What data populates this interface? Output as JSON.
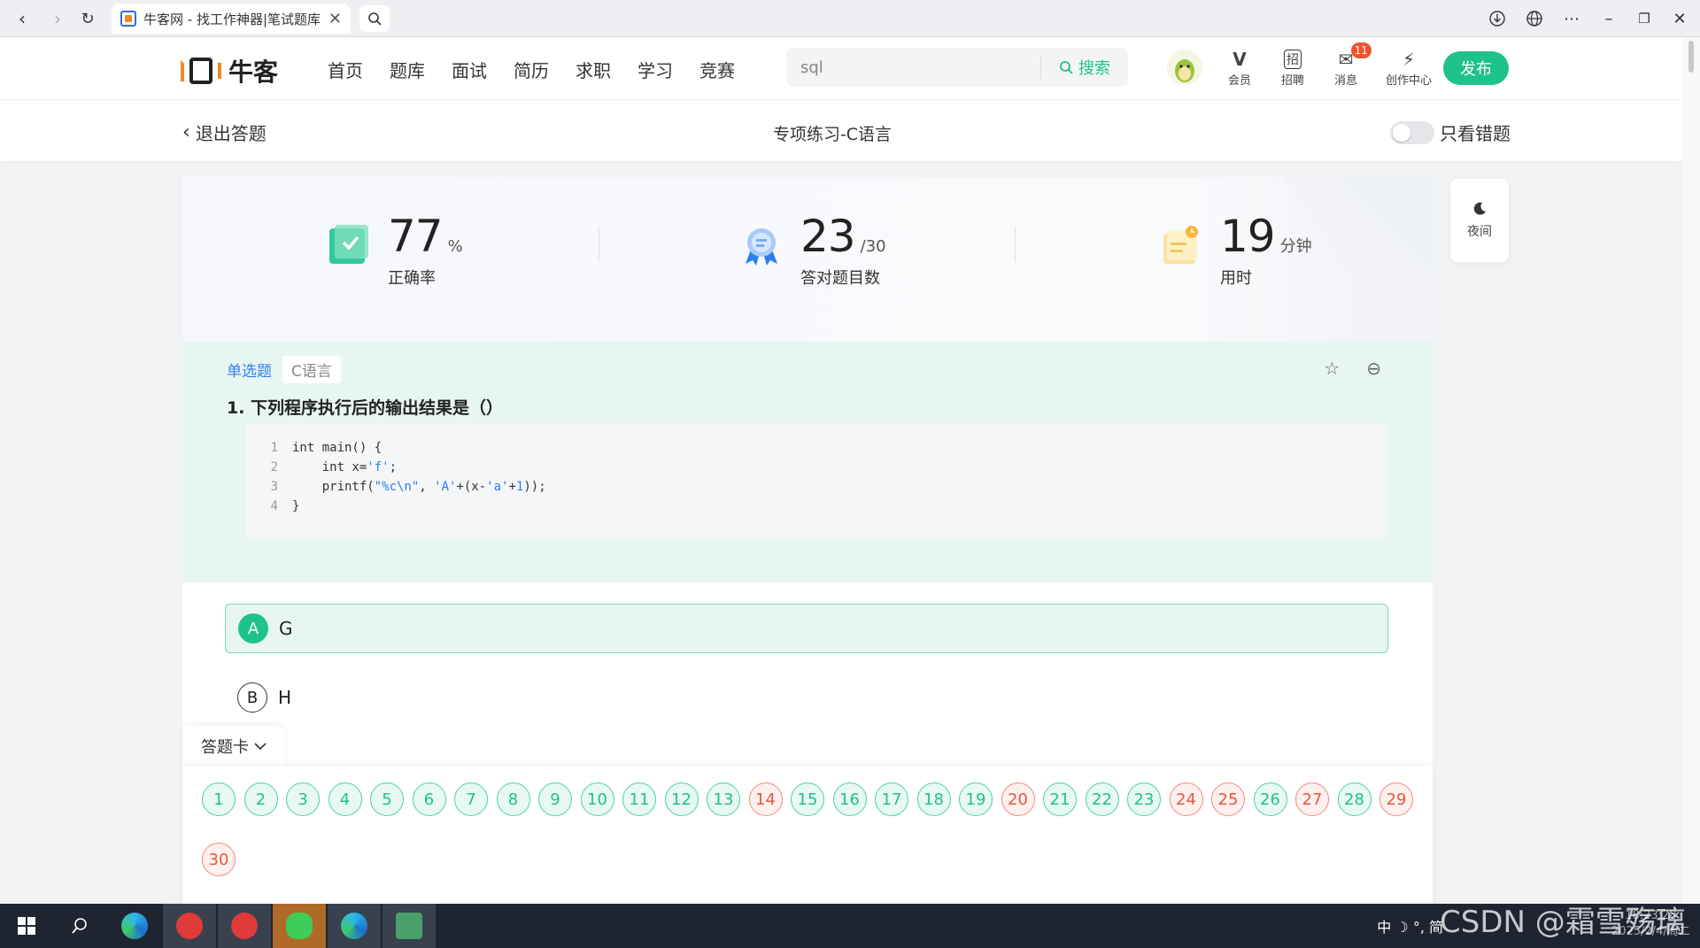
{
  "browser": {
    "tab_title": "牛客网 - 找工作神器|笔试题库",
    "close_glyph": "✕"
  },
  "header": {
    "brand": "牛客",
    "nav": [
      "首页",
      "题库",
      "面试",
      "简历",
      "求职",
      "学习",
      "竞赛"
    ],
    "search_value": "sql",
    "search_button": "搜索",
    "icons": [
      {
        "label": "会员",
        "icon": "vip-icon",
        "glyph": "V"
      },
      {
        "label": "招聘",
        "icon": "recruit-icon",
        "glyph": "招"
      },
      {
        "label": "消息",
        "icon": "message-icon",
        "glyph": "✉",
        "badge": "11"
      },
      {
        "label": "创作中心",
        "icon": "bulb-icon",
        "glyph": "⚡"
      }
    ],
    "publish": "发布"
  },
  "subheader": {
    "exit": "退出答题",
    "title": "专项练习-C语言",
    "toggle_label": "只看错题"
  },
  "stats": [
    {
      "value": "77",
      "unit": "%",
      "label": "正确率"
    },
    {
      "value": "23",
      "unit": "/30",
      "label": "答对题目数"
    },
    {
      "value": "19",
      "unit": "分钟",
      "label": "用时"
    }
  ],
  "question": {
    "type_tag": "单选题",
    "topic_tag": "C语言",
    "title": "1. 下列程序执行后的输出结果是（）",
    "code_lines": [
      {
        "n": "1",
        "text": "int main() {"
      },
      {
        "n": "2",
        "text": "    int x='f';"
      },
      {
        "n": "3",
        "text": "    printf(\"%c\\n\", 'A'+(x-'a'+1));"
      },
      {
        "n": "4",
        "text": "}"
      }
    ],
    "options": [
      {
        "letter": "A",
        "text": "G",
        "selected": true
      },
      {
        "letter": "B",
        "text": "H",
        "selected": false
      }
    ]
  },
  "answer_card": {
    "label": "答题卡",
    "items": [
      {
        "n": "1",
        "status": "ok"
      },
      {
        "n": "2",
        "status": "ok"
      },
      {
        "n": "3",
        "status": "ok"
      },
      {
        "n": "4",
        "status": "ok"
      },
      {
        "n": "5",
        "status": "ok"
      },
      {
        "n": "6",
        "status": "ok"
      },
      {
        "n": "7",
        "status": "ok"
      },
      {
        "n": "8",
        "status": "ok"
      },
      {
        "n": "9",
        "status": "ok"
      },
      {
        "n": "10",
        "status": "ok"
      },
      {
        "n": "11",
        "status": "ok"
      },
      {
        "n": "12",
        "status": "ok"
      },
      {
        "n": "13",
        "status": "ok"
      },
      {
        "n": "14",
        "status": "bad"
      },
      {
        "n": "15",
        "status": "ok"
      },
      {
        "n": "16",
        "status": "ok"
      },
      {
        "n": "17",
        "status": "ok"
      },
      {
        "n": "18",
        "status": "ok"
      },
      {
        "n": "19",
        "status": "ok"
      },
      {
        "n": "20",
        "status": "bad"
      },
      {
        "n": "21",
        "status": "ok"
      },
      {
        "n": "22",
        "status": "ok"
      },
      {
        "n": "23",
        "status": "ok"
      },
      {
        "n": "24",
        "status": "bad"
      },
      {
        "n": "25",
        "status": "bad"
      },
      {
        "n": "26",
        "status": "ok"
      },
      {
        "n": "27",
        "status": "bad"
      },
      {
        "n": "28",
        "status": "ok"
      },
      {
        "n": "29",
        "status": "bad"
      },
      {
        "n": "30",
        "status": "bad"
      }
    ]
  },
  "night_mode": "夜间",
  "taskbar": {
    "tray_text": "中 ☽ °, 简",
    "watermark": "CSDN @霜雪殇璃",
    "clock_time": "18:23:28",
    "clock_date": "2025/2/4/周二"
  },
  "colors": {
    "accent": "#1ec28b",
    "wrong": "#e8563c",
    "tag_blue": "#2b7ff0"
  }
}
